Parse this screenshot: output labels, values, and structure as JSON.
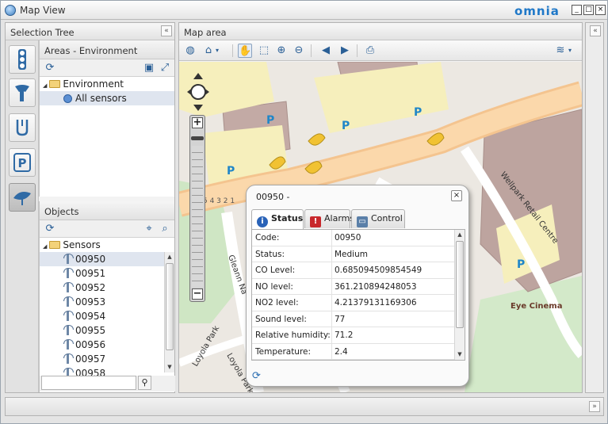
{
  "window": {
    "title": "Map View",
    "logo": "omnia",
    "btn_min": "_",
    "btn_max": "□",
    "btn_close": "×"
  },
  "selection_tree": {
    "title": "Selection Tree",
    "collapse": "«",
    "categories": [
      "traffic-light",
      "sensor",
      "route",
      "parking",
      "environment"
    ],
    "areas": {
      "title": "Areas - Environment",
      "items": [
        {
          "label": "Environment"
        },
        {
          "label": "All sensors"
        }
      ]
    },
    "objects": {
      "title": "Objects",
      "root": "Sensors",
      "sensors": [
        "00950",
        "00951",
        "00952",
        "00953",
        "00954",
        "00955",
        "00956",
        "00957",
        "00958"
      ],
      "search_placeholder": ""
    }
  },
  "map_area": {
    "title": "Map area",
    "collapse": "«",
    "labels": {
      "street1": "Wellpark Retail Centre",
      "street2": "Loyola Park",
      "street3": "Loyola Park",
      "street4": "Gleann Na",
      "cinema": "Eye Cinema",
      "scale": "5 4 3 2 1",
      "parking": "P"
    }
  },
  "popup": {
    "title": "00950 -",
    "close": "×",
    "tabs": [
      {
        "label": "Status"
      },
      {
        "label": "Alarms"
      },
      {
        "label": "Control"
      }
    ],
    "rows": [
      {
        "key": "Code:",
        "value": "00950"
      },
      {
        "key": "Status:",
        "value": "Medium"
      },
      {
        "key": "CO Level:",
        "value": "0.685094509854549"
      },
      {
        "key": "NO level:",
        "value": "361.210894248053"
      },
      {
        "key": "NO2 level:",
        "value": "4.21379131169306"
      },
      {
        "key": "Sound level:",
        "value": "77"
      },
      {
        "key": "Relative humidity:",
        "value": "71.2"
      },
      {
        "key": "Temperature:",
        "value": "2.4"
      }
    ]
  },
  "right_panel": {
    "collapse": "«"
  },
  "statusbar": {
    "expand": "»"
  },
  "colors": {
    "accent": "#1f78c8",
    "road": "#fdd6a4",
    "parking": "#f7efb7",
    "building": "#bfa9a3",
    "green": "#cde9c3"
  }
}
